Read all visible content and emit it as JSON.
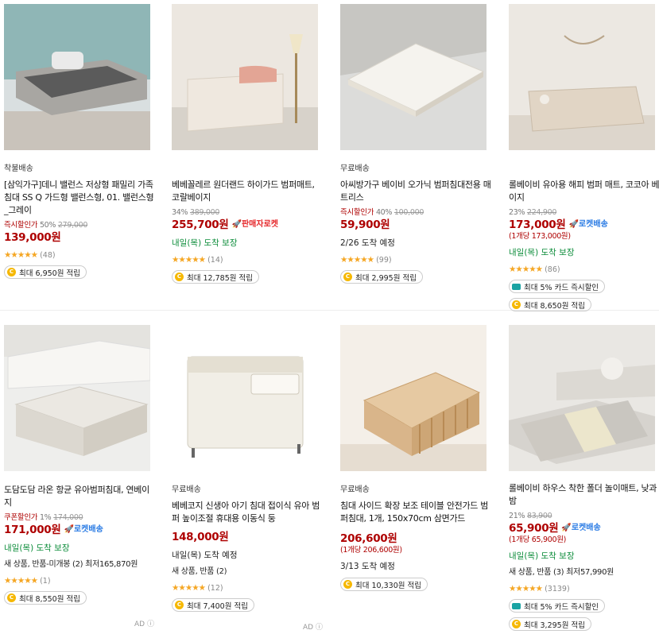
{
  "products": [
    {
      "badge": "착불배송",
      "name": "[삼익가구]데니 밸런스 저상형 패밀리 가족침대 SS Q 가드형 밸런스형, 01. 밸런스형_그레이",
      "instant_label": "즉시할인가",
      "discount": "50%",
      "original": "279,000",
      "price": "139,000원",
      "rating_count": "(48)",
      "reward": "최대 6,950원 적립"
    },
    {
      "badge": "",
      "name": "베베꼴레르 원더랜드 하이가드 범퍼매트, 코랄베이지",
      "discount": "34%",
      "original": "389,000",
      "price": "255,700원",
      "rocket": "판매자로켓",
      "delivery": "내일(목) 도착 보장",
      "rating_count": "(14)",
      "reward": "최대 12,785원 적립"
    },
    {
      "badge": "무료배송",
      "name": "아씨방가구 베이비 오가닉 범퍼침대전용 매트리스",
      "instant_label": "즉시할인가",
      "discount": "40%",
      "original": "100,000",
      "price": "59,900원",
      "delivery": "2/26 도착 예정",
      "rating_count": "(99)",
      "reward": "최대 2,995원 적립"
    },
    {
      "badge": "",
      "name": "롤베이비 유아용 해피 범퍼 매트, 코코아 베이지",
      "discount": "23%",
      "original": "224,900",
      "price": "173,000원",
      "rocket": "로켓배송",
      "unit": "(1개당 173,000원)",
      "delivery": "내일(목) 도착 보장",
      "rating_count": "(86)",
      "card_offer": "최대 5% 카드 즉시할인",
      "reward": "최대 8,650원 적립"
    },
    {
      "badge": "",
      "name": "도담도담 라온 항균 유아범퍼침대, 연베이지",
      "coupon_label": "쿠폰할인가",
      "discount": "1%",
      "original": "174,000",
      "price": "171,000원",
      "rocket": "로켓배송",
      "delivery": "내일(목) 도착 보장",
      "extra": "새 상품, 반품-미개봉 (2) 최저165,870원",
      "rating_count": "(1)",
      "reward": "최대 8,550원 적립",
      "ad": "AD"
    },
    {
      "badge": "무료배송",
      "name": "베베코지 신생아 아기 침대 접이식 유아 범퍼 높이조절 휴대용 이동식 둥",
      "price": "148,000원",
      "delivery": "내일(목) 도착 예정",
      "extra": "새 상품, 반품 (2)",
      "rating_count": "(12)",
      "reward": "최대 7,400원 적립",
      "ad": "AD"
    },
    {
      "badge": "무료배송",
      "name": "침대 사이드 확장 보조 테이블 안전가드 범퍼침대, 1개, 150x70cm 삼면가드",
      "price": "206,600원",
      "unit": "(1개당 206,600원)",
      "delivery": "3/13 도착 예정",
      "reward": "최대 10,330원 적립"
    },
    {
      "badge": "",
      "name": "롤베이비 하우스 착한 폴더 놀이매트, 낮과밤",
      "discount": "21%",
      "original": "83,900",
      "price": "65,900원",
      "rocket": "로켓배송",
      "unit": "(1개당 65,900원)",
      "delivery": "내일(목) 도착 보장",
      "extra": "새 상품, 반품 (3) 최저57,990원",
      "rating_count": "(3139)",
      "card_offer": "최대 5% 카드 즉시할인",
      "reward": "최대 3,295원 적립"
    }
  ],
  "icons": {
    "star": "★",
    "rocket": "rocket-icon",
    "coin": "C",
    "info": "ⓘ"
  }
}
